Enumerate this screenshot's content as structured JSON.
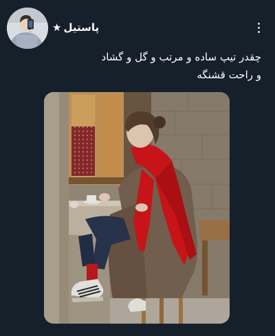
{
  "author": {
    "display_name": "پاستیل",
    "name_emoji": "★",
    "avatar_icon": "avatar-photo"
  },
  "actions": {
    "more_icon": "more-vertical-icon"
  },
  "tweet": {
    "text_lines": [
      "چقدر تیپ ساده و مرتب و گل و گشاد",
      "و راحت قشنگه"
    ]
  },
  "media": {
    "kind": "photo",
    "colors": {
      "scarf": "#d3161b",
      "coat": "#7a6452",
      "jeans": "#2a3650",
      "wall": "#9a8d7c"
    }
  }
}
